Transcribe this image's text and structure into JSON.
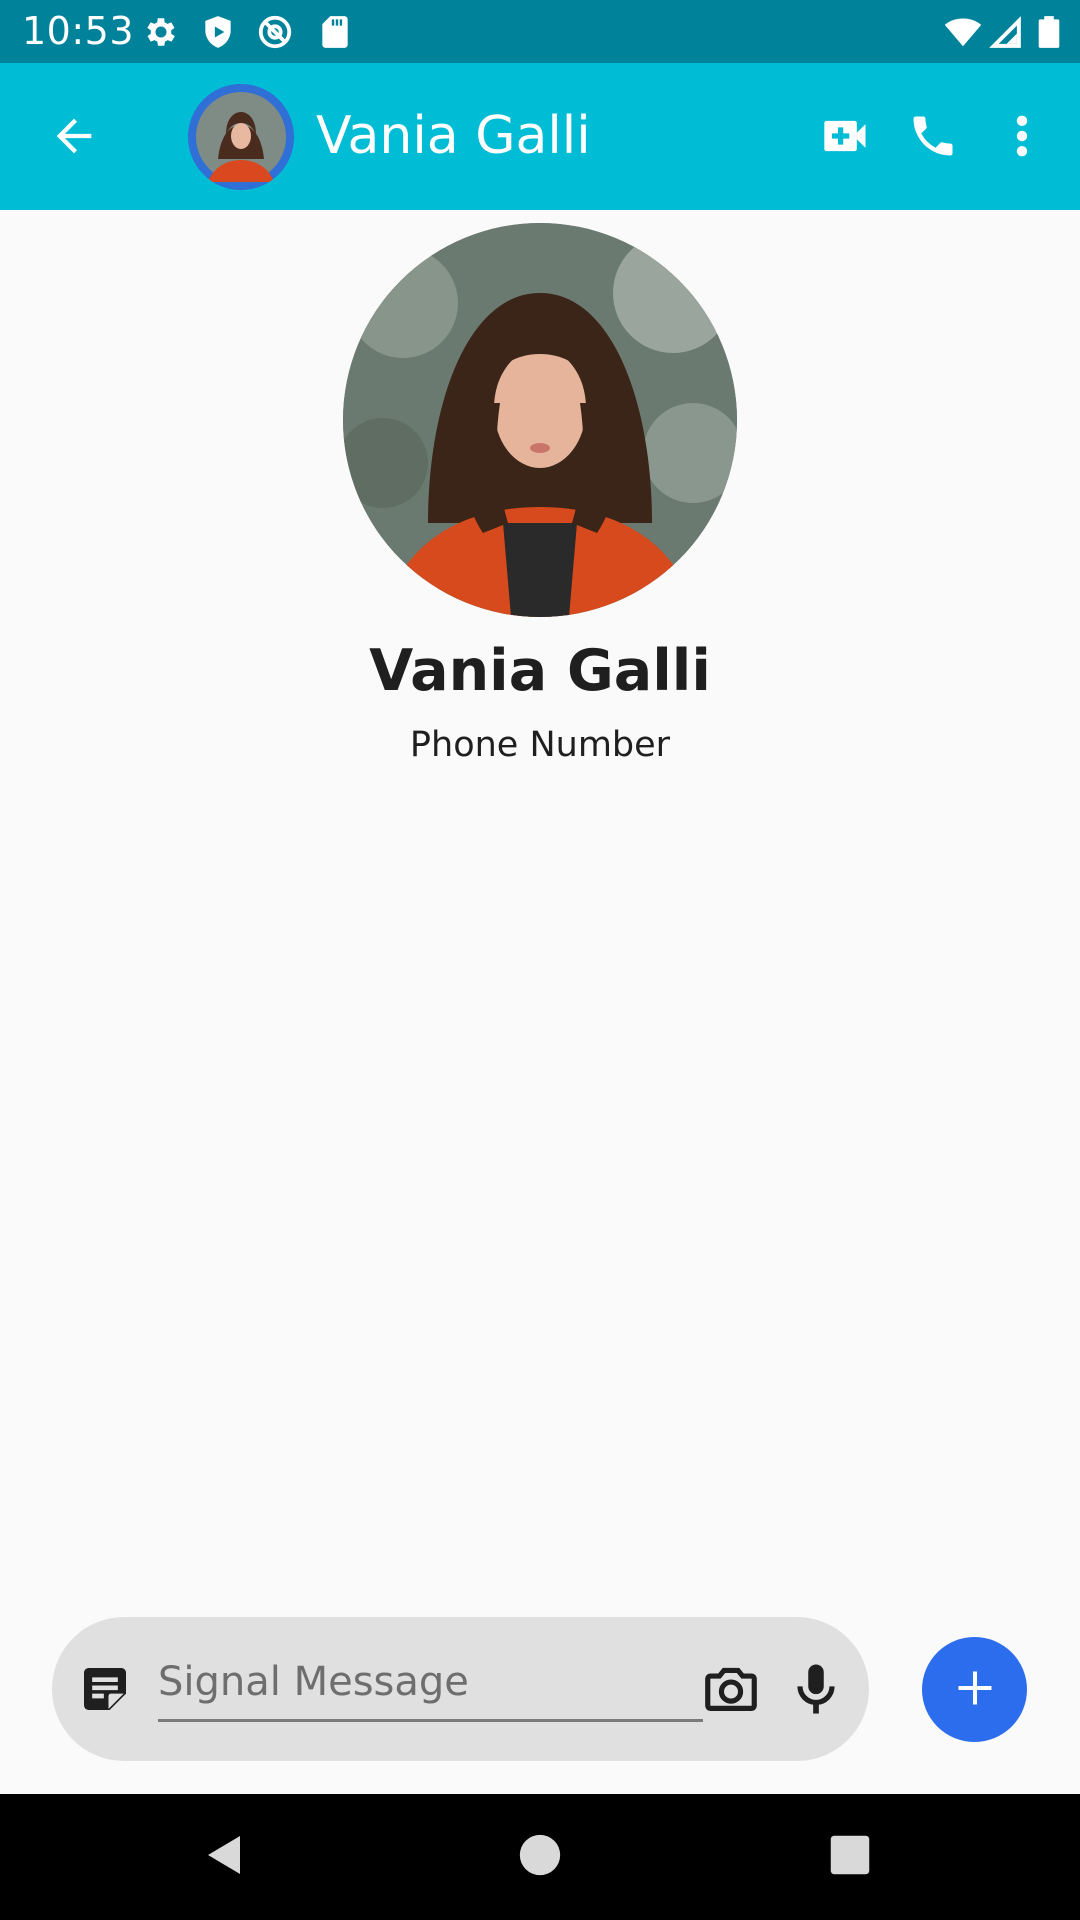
{
  "status_bar": {
    "time": "10:53",
    "icons": [
      "gear-icon",
      "shield-icon",
      "at-sign-icon",
      "sd-card-icon",
      "wifi-icon",
      "signal-icon",
      "battery-icon"
    ]
  },
  "app_bar": {
    "title": "Vania Galli",
    "icons": [
      "back-arrow-icon",
      "video-call-icon",
      "phone-icon",
      "more-vert-icon"
    ],
    "color": "#00bcd4",
    "status_color": "#00829a"
  },
  "profile": {
    "name": "Vania Galli",
    "subtitle": "Phone Number"
  },
  "compose": {
    "placeholder": "Signal Message",
    "value": "",
    "icons": [
      "sticker-icon",
      "camera-icon",
      "microphone-icon",
      "plus-icon"
    ],
    "accent": "#2c6ded"
  },
  "nav_bar": {
    "icons": [
      "back-triangle-icon",
      "home-circle-icon",
      "recents-square-icon"
    ]
  }
}
